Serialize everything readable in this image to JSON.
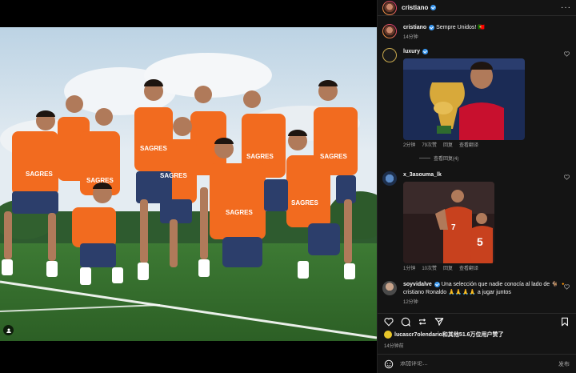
{
  "post": {
    "author": "cristiano",
    "caption_author": "cristiano",
    "caption_text": "Sempre Unidos! 🇵🇹",
    "caption_time": "14分钟",
    "likes_user": "lucascr7olendario",
    "likes_text": "和其他51.6万位用户赞了",
    "time": "14分钟前",
    "comment_placeholder": "添加评论…",
    "post_label": "发布"
  },
  "comments": [
    {
      "user": "luxury",
      "time": "2分钟",
      "likes": "79次赞",
      "reply": "回复",
      "translate": "查看翻译",
      "view_replies": "查看回复(4)"
    },
    {
      "user": "x_3asouma_lk",
      "time": "1分钟",
      "likes": "10次赞",
      "reply": "回复",
      "translate": "查看翻译"
    },
    {
      "user": "soyvidalve",
      "text_a": "Una selección que nadie conocía al lado de 🐐",
      "mention": "🔸 cristiano Ronaldo",
      "text_b": "🙏🙏🙏🙏 a jugar juntos",
      "time": "12分钟"
    }
  ],
  "icons": {
    "more": "more-horizontal-icon",
    "like": "heart-icon",
    "comment": "comment-icon",
    "repost": "repost-icon",
    "share": "share-icon",
    "bookmark": "bookmark-icon",
    "emoji": "emoji-icon",
    "user_tag": "user-tag-icon"
  },
  "colors": {
    "verified": "#3897f0",
    "jersey": "#f26b1f",
    "panel_bg": "#141414"
  },
  "chart_data": null
}
